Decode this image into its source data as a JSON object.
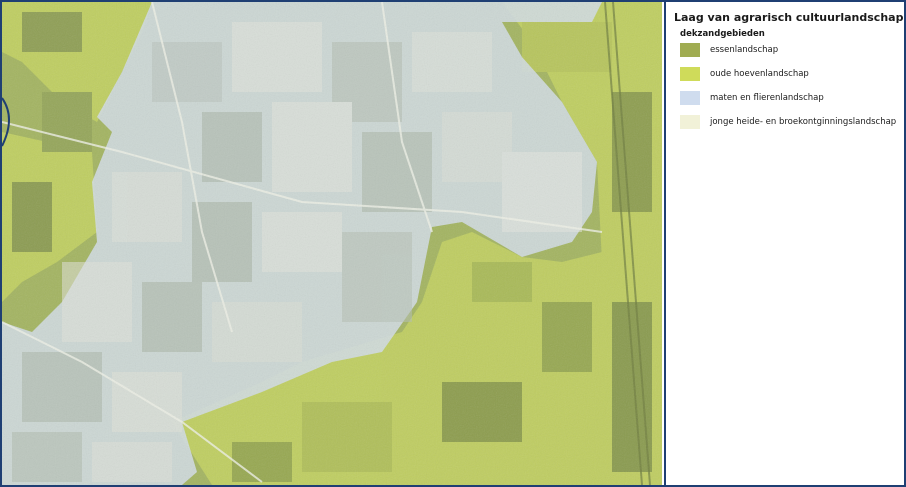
{
  "legend": {
    "title": "Laag van agrarisch cultuurlandschap",
    "subtitle": "dekzandgebieden",
    "items": [
      {
        "label": "essenlandschap",
        "color": "#a0ac52"
      },
      {
        "label": "oude hoevenlandschap",
        "color": "#cfdb5a"
      },
      {
        "label": "maten en flierenlandschap",
        "color": "#cfdcee"
      },
      {
        "label": "jonge heide- en broekontginningslandschap",
        "color": "#f1f1d8"
      }
    ]
  },
  "map": {
    "base_green": "#9fae63",
    "hoeven_color": "#c2d05e",
    "maten_color": "#d3dee8",
    "border_color": "#1f3f73"
  }
}
